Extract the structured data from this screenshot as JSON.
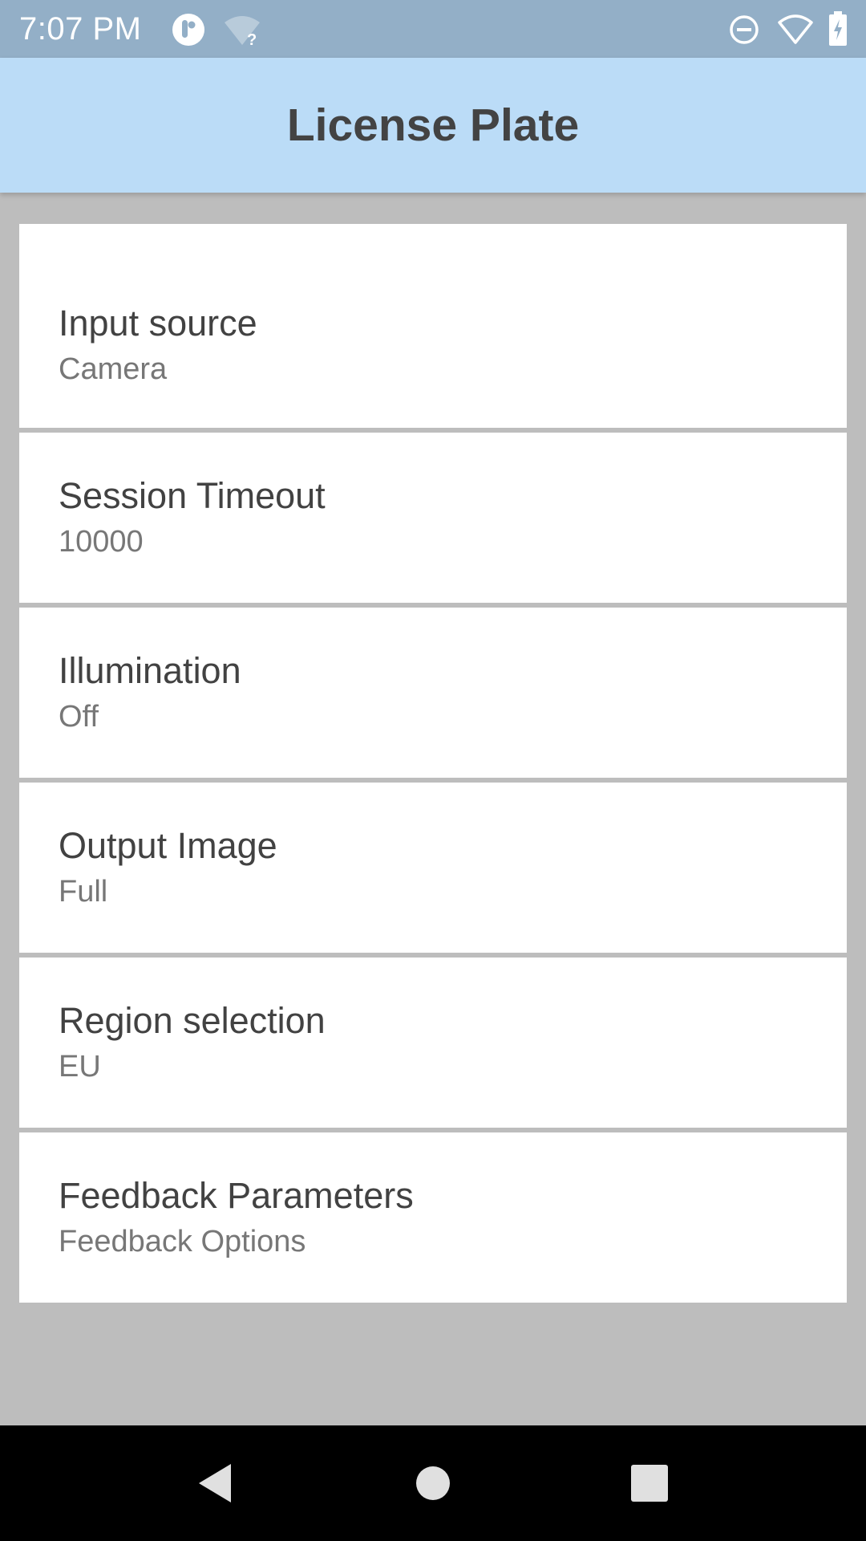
{
  "status_bar": {
    "time": "7:07 PM",
    "icons": [
      "app-notification-icon",
      "wifi-question-icon",
      "do-not-disturb-icon",
      "wifi-icon",
      "battery-charging-icon"
    ]
  },
  "app_bar": {
    "title": "License Plate"
  },
  "settings": [
    {
      "title": "Input source",
      "value": "Camera"
    },
    {
      "title": "Session Timeout",
      "value": "10000"
    },
    {
      "title": "Illumination",
      "value": "Off"
    },
    {
      "title": "Output Image",
      "value": "Full"
    },
    {
      "title": "Region selection",
      "value": "EU"
    },
    {
      "title": "Feedback Parameters",
      "value": "Feedback Options"
    }
  ],
  "nav_bar": {
    "buttons": [
      "back-icon",
      "home-icon",
      "recents-icon"
    ]
  },
  "colors": {
    "status_bar": "#93afc7",
    "app_bar": "#bbdcf7",
    "background": "#bdbdbd",
    "card": "#ffffff",
    "title_text": "#424242",
    "value_text": "#777777"
  }
}
